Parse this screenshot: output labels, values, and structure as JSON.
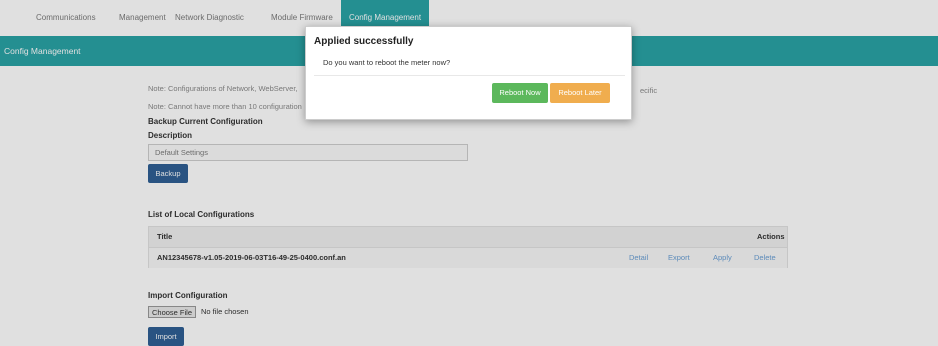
{
  "nav": {
    "tabs": [
      {
        "label": "Communications"
      },
      {
        "label": "Management"
      },
      {
        "label": "Network Diagnostic"
      },
      {
        "label": "Module Firmware"
      },
      {
        "label": "Config Management"
      }
    ],
    "active_index": 4
  },
  "section": {
    "title": "Config Management"
  },
  "notes": {
    "note1": "Note: Configurations of Network, WebServer,",
    "note1_tail": "ecific",
    "note2": "Note: Cannot have more than 10 configuration"
  },
  "backup": {
    "heading": "Backup Current Configuration",
    "description_label": "Description",
    "description_value": "Default Settings",
    "button_label": "Backup"
  },
  "local_configs": {
    "heading": "List of Local Configurations",
    "columns": {
      "title": "Title",
      "actions": "Actions"
    },
    "rows": [
      {
        "title": "AN12345678-v1.05-2019-06-03T16-49-25-0400.conf.an",
        "actions": [
          "Detail",
          "Export",
          "Apply",
          "Delete"
        ]
      }
    ]
  },
  "import": {
    "heading": "Import Configuration",
    "choose_label": "Choose File",
    "file_status": "No file chosen",
    "button_label": "Import"
  },
  "modal": {
    "title": "Applied successfully",
    "message": "Do you want to reboot the meter now?",
    "reboot_now_label": "Reboot Now",
    "reboot_later_label": "Reboot Later"
  },
  "colors": {
    "teal": "#2aa3a6",
    "primary_blue": "#2f5f94",
    "success_green": "#5cb85c",
    "warning_orange": "#f0ad4e",
    "link_blue": "#6a9fd4"
  }
}
